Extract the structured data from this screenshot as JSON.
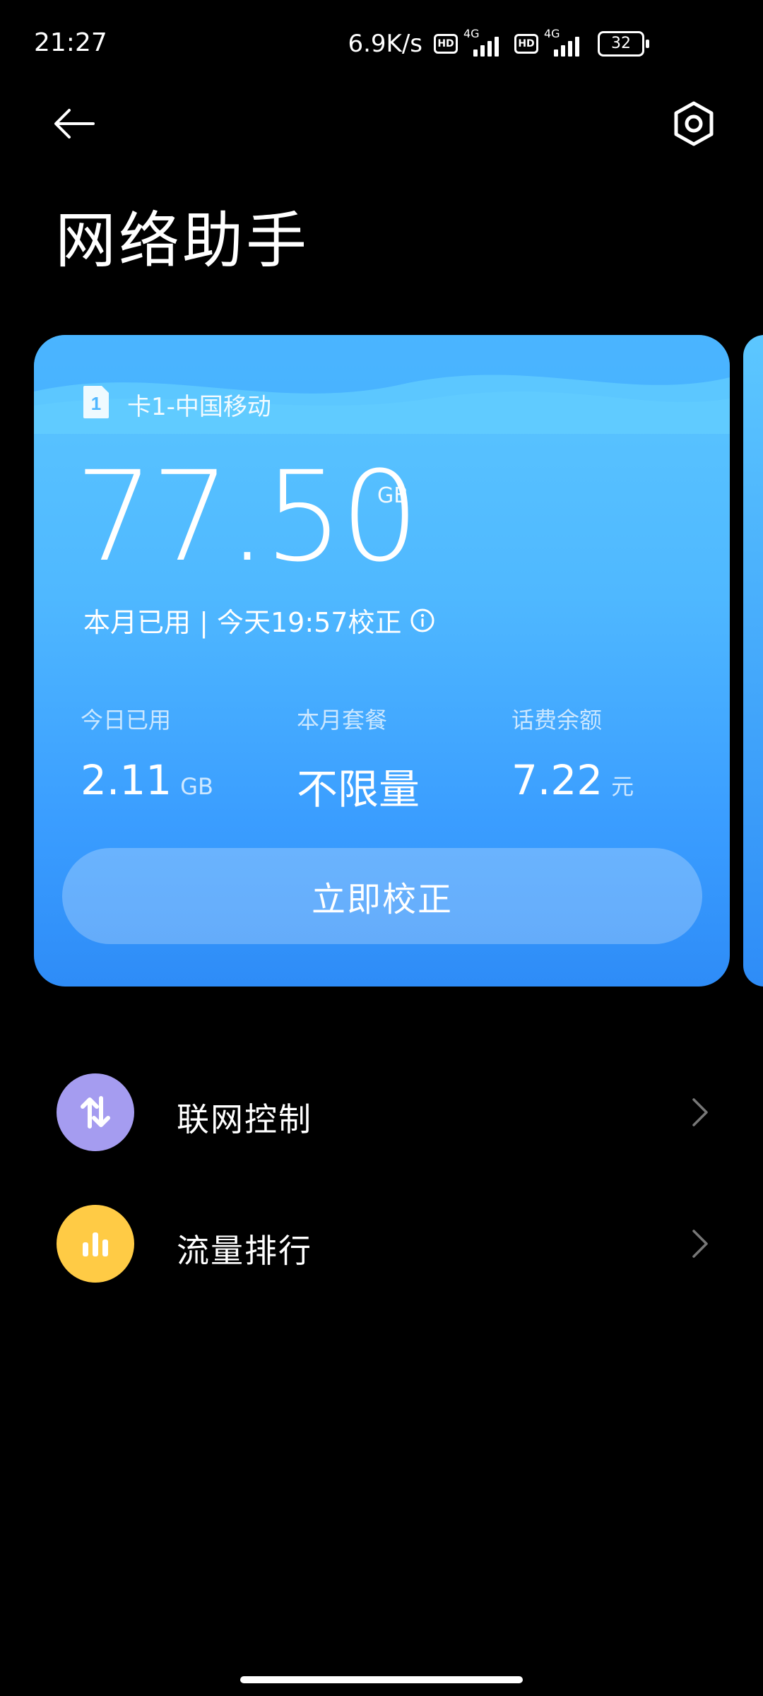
{
  "status_bar": {
    "time": "21:27",
    "speed": "6.9K/s",
    "hd": "HD",
    "network": "4G",
    "battery": "32"
  },
  "header": {
    "title": "网络助手",
    "back_icon": "arrow-left-icon",
    "settings_icon": "hexagon-settings-icon"
  },
  "card": {
    "sim_number": "1",
    "sim_label": "卡1-中国移动",
    "usage_value": "77.50",
    "usage_unit": "GB",
    "usage_caption": "本月已用 | 今天19:57校正",
    "stats": [
      {
        "label": "今日已用",
        "value": "2.11",
        "unit": "GB"
      },
      {
        "label": "本月套餐",
        "value": "不限量",
        "unit": ""
      },
      {
        "label": "话费余额",
        "value": "7.22",
        "unit": "元"
      }
    ],
    "calibrate_label": "立即校正"
  },
  "menu": [
    {
      "label": "联网控制",
      "icon": "up-down-arrows-icon",
      "color": "#a59cf0"
    },
    {
      "label": "流量排行",
      "icon": "bar-chart-icon",
      "color": "#ffcb45"
    }
  ],
  "colors": {
    "card_top": "#5cc7ff",
    "card_bottom": "#2e8cf7"
  }
}
